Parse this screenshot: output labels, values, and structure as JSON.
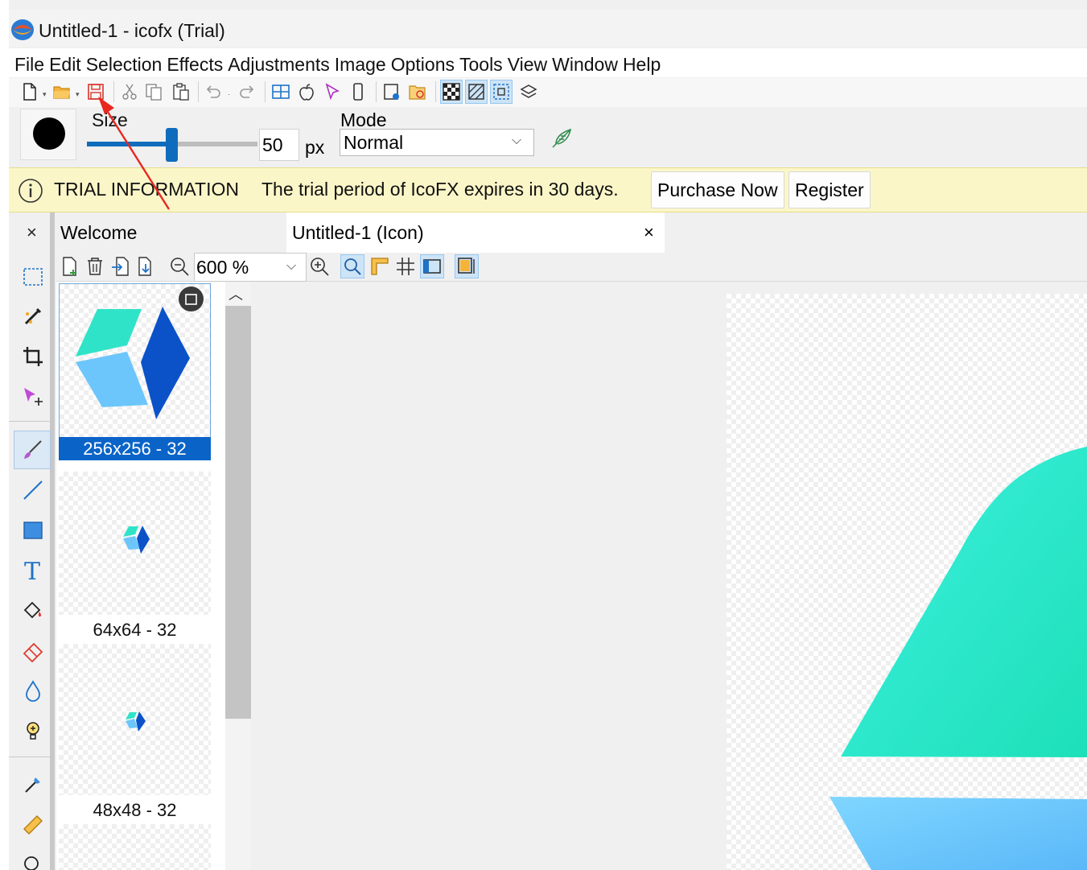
{
  "window": {
    "title": "Untitled-1 - icofx (Trial)"
  },
  "menu": [
    "File",
    "Edit",
    "Selection",
    "Effects",
    "Adjustments",
    "Image",
    "Options",
    "Tools",
    "View",
    "Window",
    "Help"
  ],
  "toolbar": {
    "icons": [
      "new-file-icon",
      "open-folder-icon",
      "save-icon",
      "cut-icon",
      "copy-icon",
      "paste-icon",
      "undo-icon",
      "redo-icon",
      "windows-icon",
      "apple-icon",
      "cursor-icon",
      "mobile-icon",
      "new-image-icon",
      "open-image-icon",
      "checkerboard-icon",
      "transparency-icon",
      "selection-preview-icon",
      "layers-icon"
    ]
  },
  "brush": {
    "size_label": "Size",
    "size_value": "50",
    "size_fraction": 0.5,
    "unit": "px",
    "mode_label": "Mode",
    "mode_value": "Normal"
  },
  "trial": {
    "title": "TRIAL INFORMATION",
    "message": "The trial period of IcoFX expires in 30 days.",
    "purchase_label": "Purchase Now",
    "register_label": "Register"
  },
  "tabs": {
    "panel_close": "×",
    "welcome": "Welcome",
    "document": "Untitled-1 (Icon)",
    "document_close": "×"
  },
  "zoom": {
    "value": "600 %"
  },
  "thumbnails": [
    {
      "label": "256x256 - 32",
      "selected": true
    },
    {
      "label": "64x64 - 32",
      "selected": false
    },
    {
      "label": "48x48 - 32",
      "selected": false
    }
  ],
  "colors": {
    "accent": "#0a64c8",
    "trial_bg": "#fbf6c8",
    "cube_teal": "#2fe3c8",
    "cube_light_blue": "#6cc6fb",
    "cube_dark_blue": "#0b52c9",
    "annotation_arrow": "#e8271f"
  }
}
